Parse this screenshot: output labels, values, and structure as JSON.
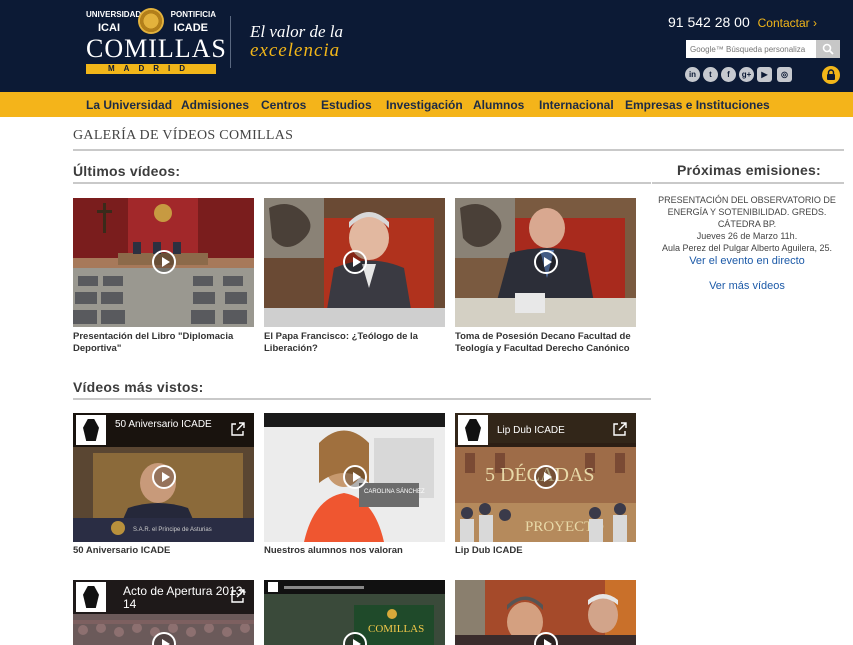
{
  "header": {
    "logo": {
      "top_left": "UNIVERSIDAD",
      "top_right": "PONTIFICIA",
      "icai": "ICAI",
      "icade": "ICADE",
      "name": "COMILLAS",
      "city": "MADRID"
    },
    "slogan_line1": "El valor de la",
    "slogan_line2": "excelencia",
    "phone": "91 542 28 00",
    "contact_label": "Contactar ›",
    "search_placeholder": "Google™ Búsqueda personaliza",
    "social_icons": [
      "linkedin-icon",
      "twitter-icon",
      "facebook-icon",
      "googleplus-icon",
      "youtube-icon",
      "instagram-icon"
    ],
    "social_glyphs": [
      "in",
      "t",
      "f",
      "g+",
      "▶",
      "◎"
    ]
  },
  "nav": {
    "items": [
      "La Universidad",
      "Admisiones",
      "Centros",
      "Estudios",
      "Investigación",
      "Alumnos",
      "Internacional",
      "Empresas e Instituciones"
    ]
  },
  "page": {
    "title": "GALERÍA DE VÍDEOS COMILLAS"
  },
  "latest": {
    "title": "Últimos vídeos:",
    "videos": [
      {
        "caption": "Presentación del Libro \"Diplomacia Deportiva\""
      },
      {
        "caption": "El Papa Francisco: ¿Teólogo de la Liberación?"
      },
      {
        "caption": "Toma de Posesión Decano Facultad de Teología y Facultad Derecho Canónico"
      }
    ]
  },
  "most_viewed": {
    "title": "Vídeos más vistos:",
    "videos": [
      {
        "overlay_title": "50 Aniversario ICADE",
        "caption": "50 Aniversario ICADE"
      },
      {
        "overlay_title": "",
        "caption": "Nuestros alumnos nos valoran"
      },
      {
        "overlay_title": "Lip Dub ICADE",
        "caption": "Lip Dub ICADE"
      },
      {
        "overlay_title": "Acto de Apertura 2013-14",
        "caption": ""
      },
      {
        "overlay_title": "",
        "caption": ""
      },
      {
        "overlay_title": "",
        "caption": ""
      }
    ],
    "thumb_text": {
      "name_tag": "CAROLINA SÁNCHEZ",
      "decadas": "5 DÉCADAS",
      "proyecto": "PROYECTO",
      "principe": "S.A.R. el Príncipe de Asturias",
      "comillas_banner": "COMILLAS"
    }
  },
  "sidebar": {
    "title": "Próximas emisiones:",
    "event_lines": [
      "PRESENTACIÓN DEL OBSERVATORIO DE",
      "ENERGÍA Y SOTENIBILIDAD. GREDS.",
      "CÁTEDRA BP.",
      "Jueves 26 de Marzo 11h.",
      "Aula Perez del Pulgar Alberto Aguilera, 25."
    ],
    "live_link": "Ver el evento en directo",
    "more_link": "Ver más vídeos"
  },
  "colors": {
    "header_bg": "#0c1a35",
    "accent": "#f4b41a",
    "link": "#1c5aa8"
  }
}
